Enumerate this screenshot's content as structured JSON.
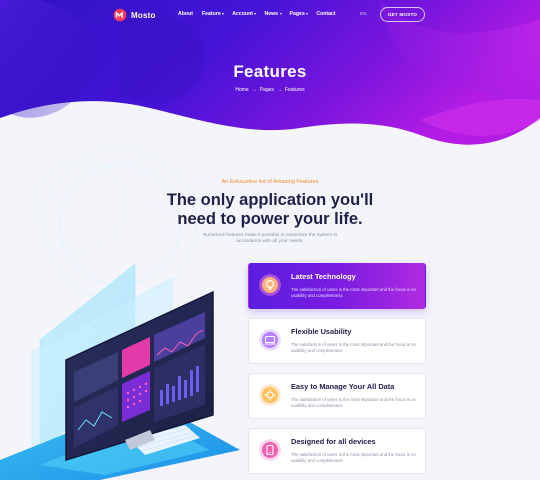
{
  "brand": {
    "name": "Mosto"
  },
  "nav": {
    "links": [
      {
        "label": "About",
        "has_menu": false
      },
      {
        "label": "Feature",
        "has_menu": true
      },
      {
        "label": "Account",
        "has_menu": true
      },
      {
        "label": "News",
        "has_menu": true
      },
      {
        "label": "Pages",
        "has_menu": true
      },
      {
        "label": "Contact",
        "has_menu": false
      }
    ],
    "language": "EN",
    "cta_label": "GET MOSTO"
  },
  "hero": {
    "title": "Features",
    "breadcrumb": [
      "Home",
      "Pages",
      "Features"
    ]
  },
  "intro": {
    "eyebrow": "An Exhaustive list of Amazing Features",
    "headline": "The only application you'll need to power your life.",
    "lead": "Numerous features make it possible to customize the system in accordance with all your needs."
  },
  "features": [
    {
      "title": "Latest Technology",
      "description": "The satisfaction of users is the most important and the focus is on usability and completeness",
      "icon": "lightbulb-icon",
      "active": true
    },
    {
      "title": "Flexible Usability",
      "description": "The satisfaction of users is the most important and the focus is on usability and completeness",
      "icon": "laptop-icon",
      "active": false
    },
    {
      "title": "Easy to Manage Your All Data",
      "description": "The satisfaction of users is the most important and the focus is on usability and completeness",
      "icon": "settings-icon",
      "active": false
    },
    {
      "title": "Designed for all devices",
      "description": "The satisfaction of users is the most important and the focus is on usability and completeness",
      "icon": "devices-icon",
      "active": false
    }
  ],
  "colors": {
    "hero_start": "#3b12c9",
    "hero_end": "#b21ce3",
    "accent_orange": "#f08a29",
    "headline": "#1f1f47",
    "background": "#f3f5fb"
  }
}
